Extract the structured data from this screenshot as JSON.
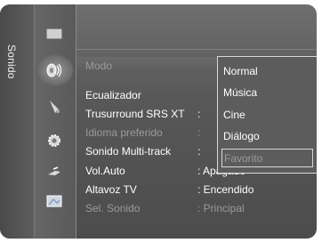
{
  "side_label": "Sonido",
  "menu_items": [
    {
      "label": "Modo",
      "value": "",
      "state": "selected"
    },
    {
      "label": "Ecualizador",
      "value": "",
      "state": "normal"
    },
    {
      "label": "Trusurround SRS XT",
      "value": ":",
      "state": "normal"
    },
    {
      "label": "Idioma preferido",
      "value": ":",
      "state": "dim"
    },
    {
      "label": "Sonido Multi-track",
      "value": ":",
      "state": "normal"
    },
    {
      "label": "Vol.Auto",
      "value": ": Apagado",
      "state": "normal"
    },
    {
      "label": "Altavoz TV",
      "value": ": Encendido",
      "state": "normal"
    },
    {
      "label": "Sel. Sonido",
      "value": ": Principal",
      "state": "dim"
    }
  ],
  "dropdown": {
    "options": [
      "Normal",
      "Música",
      "Cine",
      "Diálogo",
      "Favorito"
    ],
    "disabled_option": "Favorito"
  },
  "icons": [
    "picture-icon",
    "sound-icon",
    "channel-icon",
    "setup-icon",
    "input-icon",
    "application-icon"
  ],
  "colors": {
    "panel": "#585858",
    "text": "#ffffff",
    "disabled_text": "#9a9a9a",
    "border": "#d8d8d8"
  }
}
